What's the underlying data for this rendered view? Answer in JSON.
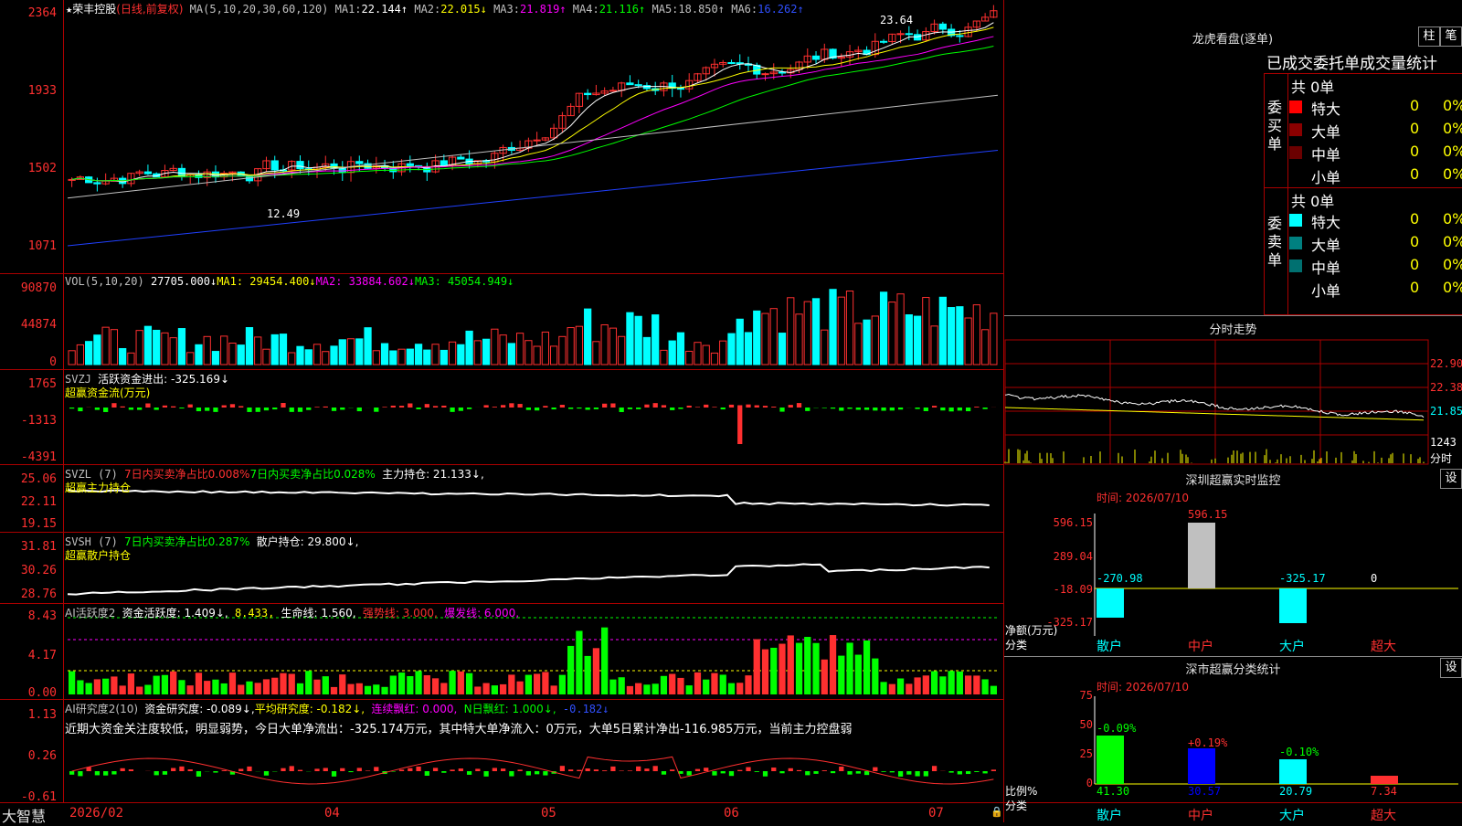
{
  "stock": {
    "star": "★",
    "name": "荣丰控股",
    "mode": "(日线,前复权)"
  },
  "ma_header": {
    "label": "MA(5,10,20,30,60,120)",
    "items": [
      {
        "name": "MA1:",
        "value": "22.144↑",
        "color": "#ffffff"
      },
      {
        "name": "MA2:",
        "value": "22.015↓",
        "color": "#ffff00"
      },
      {
        "name": "MA3:",
        "value": "21.819↑",
        "color": "#ff00ff"
      },
      {
        "name": "MA4:",
        "value": "21.116↑",
        "color": "#00ff00"
      },
      {
        "name": "MA5:",
        "value": "18.850↑",
        "color": "#c0c0c0"
      },
      {
        "name": "MA6:",
        "value": "16.262↑",
        "color": "#3050ff"
      }
    ]
  },
  "price_axis": [
    "2364",
    "1933",
    "1502",
    "1071"
  ],
  "price_annotations": {
    "high": "23.64",
    "low": "12.49"
  },
  "vol_header": {
    "label": "VOL(5,10,20)",
    "value": "27705.000↓",
    "ma1": "MA1: 29454.400↓",
    "ma2": "MA2: 33884.602↓",
    "ma3": "MA3: 45054.949↓"
  },
  "vol_axis": [
    "90870",
    "44874",
    "0"
  ],
  "svzj": {
    "label": "SVZJ",
    "line1": "活跃资金进出: -325.169↓",
    "line2": "超赢资金流(万元)",
    "axis": [
      "1765",
      "-1313",
      "-4391"
    ]
  },
  "svzl": {
    "label": "SVZL (7)",
    "a": "7日内买卖净占比0.008%",
    "b": "7日内买卖净占比0.028%",
    "c": "主力持仓: 21.133↓,",
    "line2": "超赢主力持仓",
    "axis": [
      "25.06",
      "22.11",
      "19.15"
    ]
  },
  "svsh": {
    "label": "SVSH (7)",
    "a": "7日内买卖净占比0.287%",
    "c": "散户持仓: 29.800↓,",
    "line2": "超赢散户持仓",
    "axis": [
      "31.81",
      "30.26",
      "28.76"
    ]
  },
  "ai_active": {
    "label": "AI活跃度2",
    "a": "资金活跃度: 1.409↓,",
    "b": "8.433,",
    "c": "生命线: 1.560,",
    "d": "强势线: 3.000,",
    "e": "爆发线: 6.000,",
    "axis": [
      "8.43",
      "4.17",
      "0.00"
    ]
  },
  "ai_research": {
    "label": "AI研究度2(10)",
    "a": "资金研究度: -0.089↓,",
    "b": "平均研究度: -0.182↓,",
    "c": "连续飘红: 0.000,",
    "d": "N日飘红: 1.000↓,",
    "e": "-0.182↓",
    "comment": "近期大资金关注度较低，明显弱势，今日大单净流出：-325.174万元，其中特大单净流入：0万元，大单5日累计净出-116.985万元，当前主力控盘弱",
    "axis": [
      "1.13",
      "0.26",
      "-0.61"
    ]
  },
  "bottom": {
    "brand": "大智慧",
    "dates": [
      "2026/02",
      "04",
      "05",
      "06",
      "07"
    ]
  },
  "right": {
    "dragon_title": "龙虎看盘(逐单)",
    "btn_column": "柱",
    "btn_stroke": "笔",
    "stats_title": "已成交委托单成交量统计",
    "buy": {
      "side_label": "委买单",
      "total": "共 0单",
      "rows": [
        {
          "name": "特大",
          "v": "0",
          "p": "0%",
          "color": "#ff0000"
        },
        {
          "name": "大单",
          "v": "0",
          "p": "0%",
          "color": "#8b0000"
        },
        {
          "name": "中单",
          "v": "0",
          "p": "0%",
          "color": "#6b0000"
        },
        {
          "name": "小单",
          "v": "0",
          "p": "0%",
          "color": "#000000"
        }
      ]
    },
    "sell": {
      "side_label": "委卖单",
      "total": "共 0单",
      "rows": [
        {
          "name": "特大",
          "v": "0",
          "p": "0%",
          "color": "#00ffff"
        },
        {
          "name": "大单",
          "v": "0",
          "p": "0%",
          "color": "#008080"
        },
        {
          "name": "中单",
          "v": "0",
          "p": "0%",
          "color": "#007070"
        },
        {
          "name": "小单",
          "v": "0",
          "p": "0%",
          "color": "#000000"
        }
      ]
    },
    "intraday_title": "分时走势",
    "intraday_axis": [
      "22.90",
      "22.38",
      "21.85",
      "1243",
      "分时"
    ],
    "monitor": {
      "title": "深圳超赢实时监控",
      "btn": "设",
      "time": "时间: 2026/07/10",
      "axis": [
        "596.15",
        "289.04",
        "-18.09",
        "-325.17"
      ],
      "ylabel": "净额(万元)",
      "xlabel": "分类",
      "cats": [
        "散户",
        "中户",
        "大户",
        "超大"
      ],
      "values": [
        "-270.98",
        "596.15",
        "-325.17",
        "0"
      ]
    },
    "classify": {
      "title": "深市超赢分类统计",
      "btn": "设",
      "time": "时间: 2026/07/10",
      "axis": [
        "75",
        "50",
        "25",
        "0"
      ],
      "ylabel": "比例%",
      "xlabel": "分类",
      "cats": [
        "散户",
        "中户",
        "大户",
        "超大"
      ],
      "changes": [
        "-0.09%",
        "+0.19%",
        "-0.10%"
      ],
      "values": [
        "41.30",
        "30.57",
        "20.79",
        "7.34"
      ]
    }
  }
}
